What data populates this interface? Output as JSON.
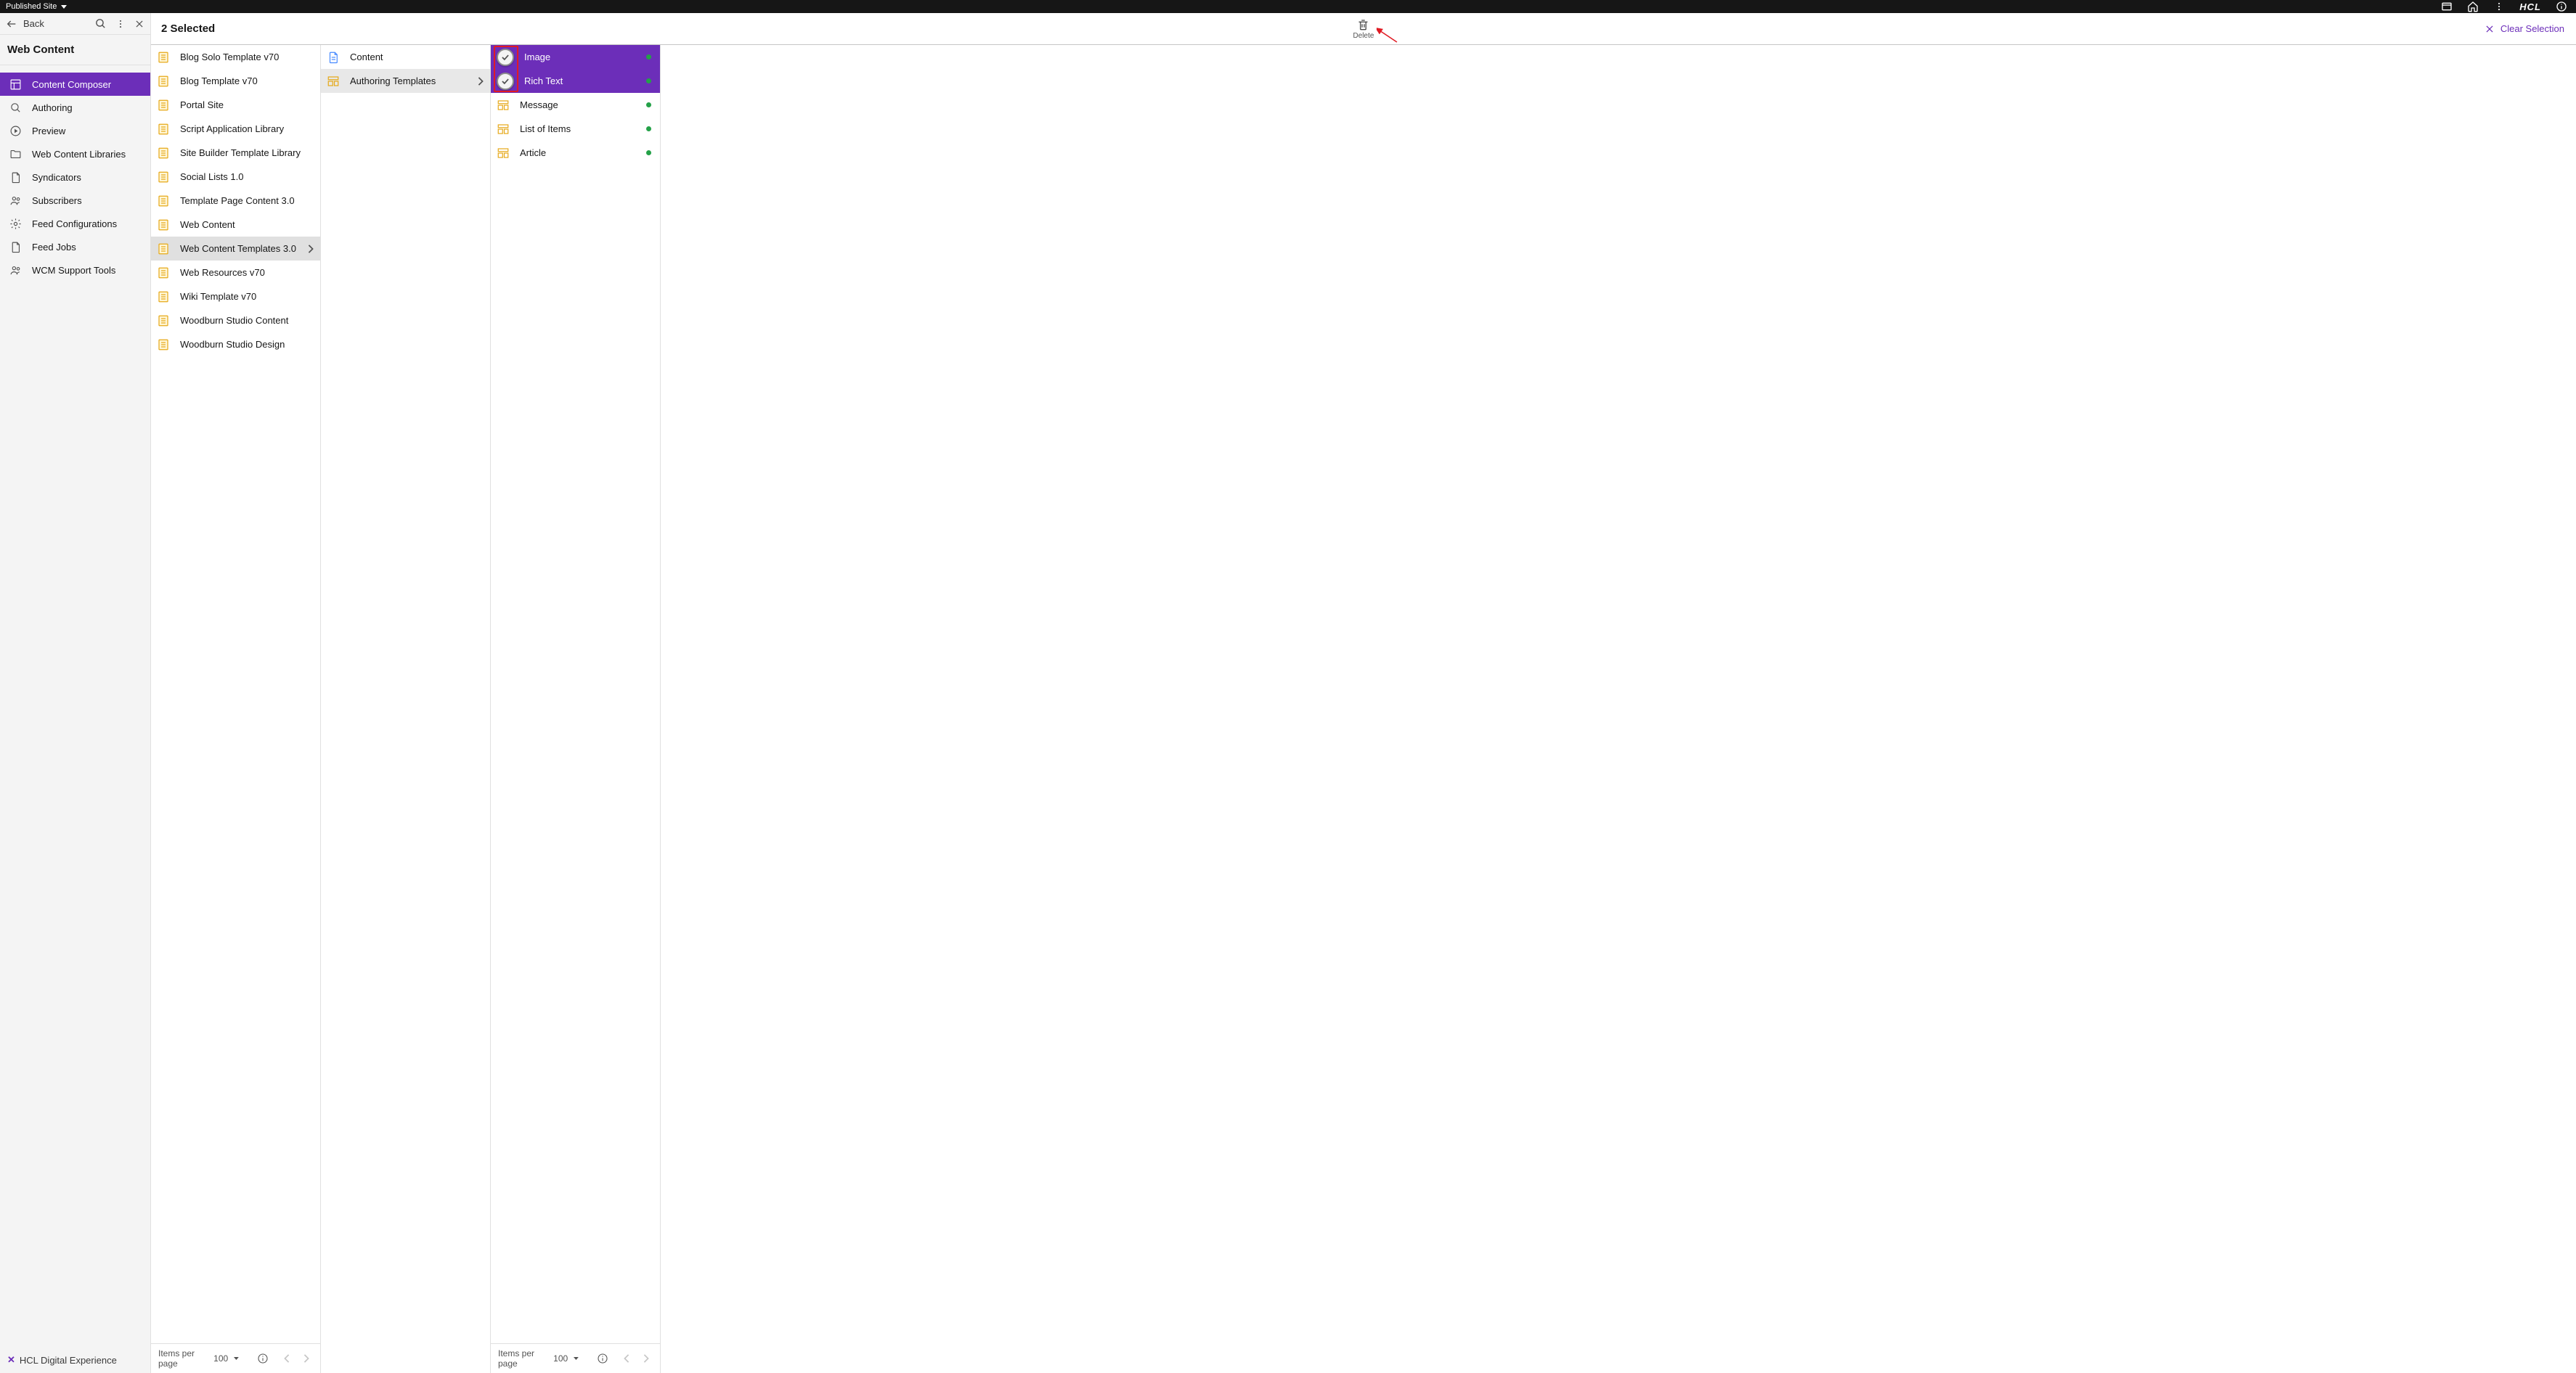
{
  "topbar": {
    "site_label": "Published Site",
    "brand": "HCL"
  },
  "sidebar": {
    "back_label": "Back",
    "title": "Web Content",
    "nav": [
      {
        "label": "Content Composer",
        "icon": "layout"
      },
      {
        "label": "Authoring",
        "icon": "search"
      },
      {
        "label": "Preview",
        "icon": "play"
      },
      {
        "label": "Web Content Libraries",
        "icon": "folder"
      },
      {
        "label": "Syndicators",
        "icon": "doc"
      },
      {
        "label": "Subscribers",
        "icon": "users"
      },
      {
        "label": "Feed Configurations",
        "icon": "gear"
      },
      {
        "label": "Feed Jobs",
        "icon": "doc"
      },
      {
        "label": "WCM Support Tools",
        "icon": "users"
      }
    ],
    "footer_brand": "HCL Digital Experience"
  },
  "header": {
    "selected_text": "2 Selected",
    "delete_label": "Delete",
    "clear_label": "Clear Selection"
  },
  "columns": {
    "col1": {
      "items": [
        {
          "label": "Blog Solo Template v70"
        },
        {
          "label": "Blog Template v70"
        },
        {
          "label": "Portal Site"
        },
        {
          "label": "Script Application Library"
        },
        {
          "label": "Site Builder Template Library"
        },
        {
          "label": "Social Lists 1.0"
        },
        {
          "label": "Template Page Content 3.0"
        },
        {
          "label": "Web Content"
        },
        {
          "label": "Web Content Templates 3.0"
        },
        {
          "label": "Web Resources v70"
        },
        {
          "label": "Wiki Template v70"
        },
        {
          "label": "Woodburn Studio Content"
        },
        {
          "label": "Woodburn Studio Design"
        }
      ],
      "expanded_index": 8,
      "pager": {
        "label": "Items per page",
        "value": "100"
      }
    },
    "col2": {
      "items": [
        {
          "label": "Content",
          "icon": "doc"
        },
        {
          "label": "Authoring Templates",
          "icon": "template"
        }
      ],
      "expanded_index": 1
    },
    "col3": {
      "items": [
        {
          "label": "Image",
          "selected": true,
          "status": "green"
        },
        {
          "label": "Rich Text",
          "selected": true,
          "status": "green"
        },
        {
          "label": "Message",
          "selected": false,
          "status": "green"
        },
        {
          "label": "List of Items",
          "selected": false,
          "status": "green"
        },
        {
          "label": "Article",
          "selected": false,
          "status": "green"
        }
      ],
      "pager": {
        "label": "Items per page",
        "value": "100"
      }
    }
  }
}
